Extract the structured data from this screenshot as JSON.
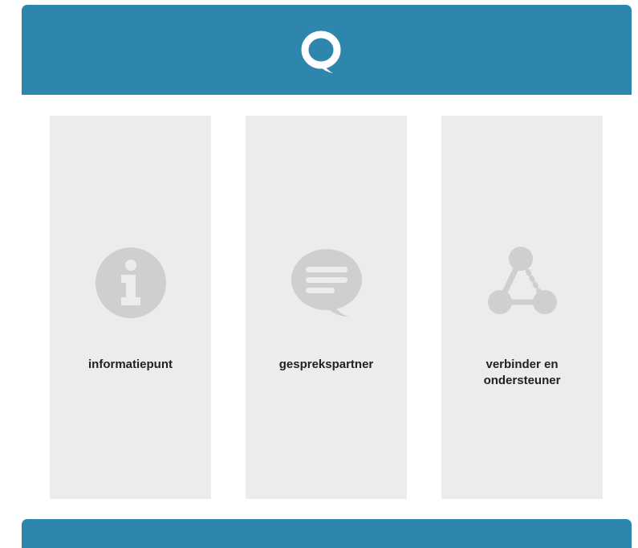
{
  "header": {
    "logo_icon": "speech-bubble-logo-icon",
    "color": "#2e86ad"
  },
  "cards": [
    {
      "label": "informatiepunt",
      "icon": "info-icon"
    },
    {
      "label": "gesprekspartner",
      "icon": "chat-bubble-icon"
    },
    {
      "label": "verbinder en ondersteuner",
      "icon": "network-nodes-icon"
    }
  ],
  "colors": {
    "accent": "#2e86ad",
    "card_bg": "#ececec",
    "icon_gray": "#cfcfcf",
    "label_text": "#222222"
  },
  "footer": {
    "color": "#2e86ad"
  }
}
